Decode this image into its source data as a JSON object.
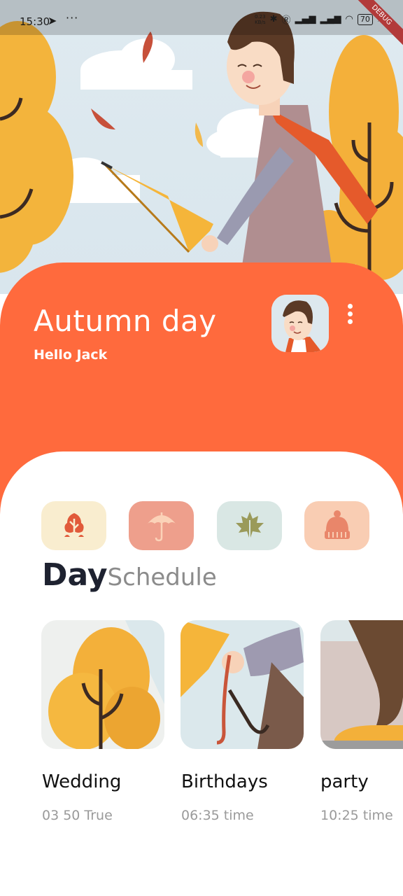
{
  "status_bar": {
    "time": "15:30",
    "net_speed_value": "0.23",
    "net_speed_unit": "KB/s",
    "battery": "70",
    "debug_label": "DEBUG"
  },
  "header": {
    "title": "Autumn day",
    "greeting": "Hello Jack"
  },
  "categories": [
    {
      "icon": "tree-icon",
      "bg": "#f9edcf",
      "fg": "#e15a3a"
    },
    {
      "icon": "umbrella-icon",
      "bg": "#ee9f8c",
      "fg": "#fbd2b8"
    },
    {
      "icon": "maple-leaf-icon",
      "bg": "#d9e7e4",
      "fg": "#9a9a5a"
    },
    {
      "icon": "beanie-hat-icon",
      "bg": "#f9cdb3",
      "fg": "#e9866a"
    }
  ],
  "schedule": {
    "title_bold": "Day",
    "title_rest": "Schedule"
  },
  "events": [
    {
      "title": "Wedding",
      "subtitle": "03 50 True"
    },
    {
      "title": "Birthdays",
      "subtitle": "06:35 time"
    },
    {
      "title": "party",
      "subtitle": "10:25 time"
    }
  ],
  "colors": {
    "accent": "#ff6a3d",
    "dark_text": "#1e2230",
    "muted_text": "#9a9a9a"
  }
}
